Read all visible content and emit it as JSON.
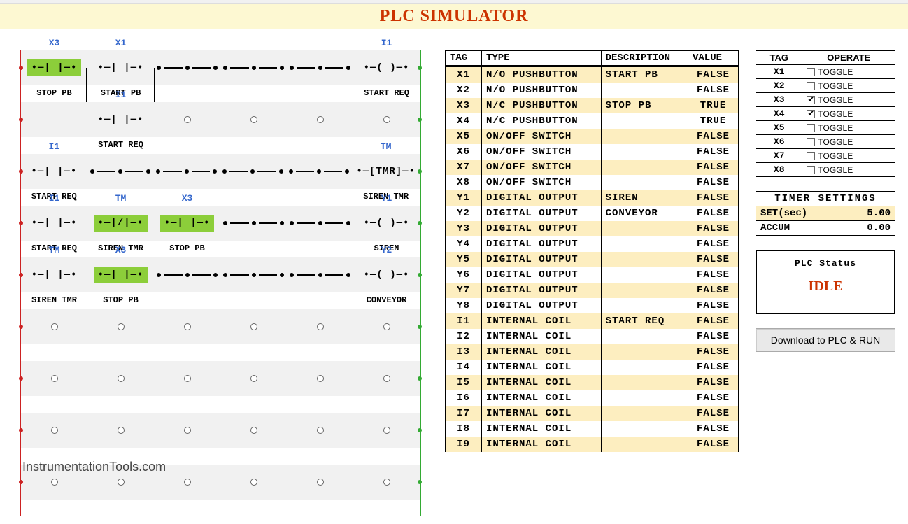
{
  "title": "PLC SIMULATOR",
  "watermark": "InstrumentationTools.com",
  "ladder": {
    "rungs": [
      {
        "slots": [
          {
            "kind": "NO",
            "tag": "X3",
            "desc": "STOP PB",
            "energized": true
          },
          {
            "kind": "NO",
            "tag": "X1",
            "desc": "START PB"
          },
          {
            "kind": "wire"
          },
          {
            "kind": "wire"
          },
          {
            "kind": "wire"
          },
          {
            "kind": "COIL",
            "tag": "I1",
            "desc": "START REQ"
          }
        ],
        "branch": {
          "under_slot": 1,
          "tag": "I1",
          "desc": "START REQ"
        }
      },
      {
        "is_branch_row": true,
        "slots": [
          {
            "kind": "empty"
          },
          {
            "kind": "NO",
            "tag": "",
            "desc": ""
          },
          {
            "kind": "hole"
          },
          {
            "kind": "hole"
          },
          {
            "kind": "hole"
          },
          {
            "kind": "hole"
          }
        ]
      },
      {
        "slots": [
          {
            "kind": "NO",
            "tag": "I1",
            "desc": "START REQ"
          },
          {
            "kind": "wire"
          },
          {
            "kind": "wire"
          },
          {
            "kind": "wire"
          },
          {
            "kind": "wire"
          },
          {
            "kind": "TMR",
            "tag": "TM",
            "desc": "SIREN TMR"
          }
        ]
      },
      {
        "slots": [
          {
            "kind": "NO",
            "tag": "I1",
            "desc": "START REQ"
          },
          {
            "kind": "NC",
            "tag": "TM",
            "desc": "SIREN TMR",
            "energized": true
          },
          {
            "kind": "NO",
            "tag": "X3",
            "desc": "STOP PB",
            "energized": true
          },
          {
            "kind": "wire"
          },
          {
            "kind": "wire"
          },
          {
            "kind": "COIL",
            "tag": "Y1",
            "desc": "SIREN"
          }
        ]
      },
      {
        "slots": [
          {
            "kind": "NO",
            "tag": "TM",
            "desc": "SIREN TMR"
          },
          {
            "kind": "NO",
            "tag": "X3",
            "desc": "STOP PB",
            "energized": true
          },
          {
            "kind": "wire"
          },
          {
            "kind": "wire"
          },
          {
            "kind": "wire"
          },
          {
            "kind": "COIL",
            "tag": "Y2",
            "desc": "CONVEYOR"
          }
        ]
      },
      {
        "slots": [
          {
            "kind": "hole"
          },
          {
            "kind": "hole"
          },
          {
            "kind": "hole"
          },
          {
            "kind": "hole"
          },
          {
            "kind": "hole"
          },
          {
            "kind": "hole"
          }
        ]
      },
      {
        "slots": [
          {
            "kind": "hole"
          },
          {
            "kind": "hole"
          },
          {
            "kind": "hole"
          },
          {
            "kind": "hole"
          },
          {
            "kind": "hole"
          },
          {
            "kind": "hole"
          }
        ]
      },
      {
        "slots": [
          {
            "kind": "hole"
          },
          {
            "kind": "hole"
          },
          {
            "kind": "hole"
          },
          {
            "kind": "hole"
          },
          {
            "kind": "hole"
          },
          {
            "kind": "hole"
          }
        ]
      },
      {
        "slots": [
          {
            "kind": "hole"
          },
          {
            "kind": "hole"
          },
          {
            "kind": "hole"
          },
          {
            "kind": "hole"
          },
          {
            "kind": "hole"
          },
          {
            "kind": "hole"
          }
        ]
      }
    ]
  },
  "tag_table": {
    "headers": [
      "TAG",
      "TYPE",
      "DESCRIPTION",
      "VALUE"
    ],
    "rows": [
      {
        "tag": "X1",
        "type": "N/O PUSHBUTTON",
        "desc": "START PB",
        "value": "FALSE"
      },
      {
        "tag": "X2",
        "type": "N/O PUSHBUTTON",
        "desc": "",
        "value": "FALSE"
      },
      {
        "tag": "X3",
        "type": "N/C PUSHBUTTON",
        "desc": "STOP PB",
        "value": "TRUE"
      },
      {
        "tag": "X4",
        "type": "N/C PUSHBUTTON",
        "desc": "",
        "value": "TRUE"
      },
      {
        "tag": "X5",
        "type": "ON/OFF SWITCH",
        "desc": "",
        "value": "FALSE"
      },
      {
        "tag": "X6",
        "type": "ON/OFF SWITCH",
        "desc": "",
        "value": "FALSE"
      },
      {
        "tag": "X7",
        "type": "ON/OFF SWITCH",
        "desc": "",
        "value": "FALSE"
      },
      {
        "tag": "X8",
        "type": "ON/OFF SWITCH",
        "desc": "",
        "value": "FALSE"
      },
      {
        "tag": "Y1",
        "type": "DIGITAL OUTPUT",
        "desc": "SIREN",
        "value": "FALSE"
      },
      {
        "tag": "Y2",
        "type": "DIGITAL OUTPUT",
        "desc": "CONVEYOR",
        "value": "FALSE"
      },
      {
        "tag": "Y3",
        "type": "DIGITAL OUTPUT",
        "desc": "",
        "value": "FALSE"
      },
      {
        "tag": "Y4",
        "type": "DIGITAL OUTPUT",
        "desc": "",
        "value": "FALSE"
      },
      {
        "tag": "Y5",
        "type": "DIGITAL OUTPUT",
        "desc": "",
        "value": "FALSE"
      },
      {
        "tag": "Y6",
        "type": "DIGITAL OUTPUT",
        "desc": "",
        "value": "FALSE"
      },
      {
        "tag": "Y7",
        "type": "DIGITAL OUTPUT",
        "desc": "",
        "value": "FALSE"
      },
      {
        "tag": "Y8",
        "type": "DIGITAL OUTPUT",
        "desc": "",
        "value": "FALSE"
      },
      {
        "tag": "I1",
        "type": "INTERNAL COIL",
        "desc": "START REQ",
        "value": "FALSE"
      },
      {
        "tag": "I2",
        "type": "INTERNAL COIL",
        "desc": "",
        "value": "FALSE"
      },
      {
        "tag": "I3",
        "type": "INTERNAL COIL",
        "desc": "",
        "value": "FALSE"
      },
      {
        "tag": "I4",
        "type": "INTERNAL COIL",
        "desc": "",
        "value": "FALSE"
      },
      {
        "tag": "I5",
        "type": "INTERNAL COIL",
        "desc": "",
        "value": "FALSE"
      },
      {
        "tag": "I6",
        "type": "INTERNAL COIL",
        "desc": "",
        "value": "FALSE"
      },
      {
        "tag": "I7",
        "type": "INTERNAL COIL",
        "desc": "",
        "value": "FALSE"
      },
      {
        "tag": "I8",
        "type": "INTERNAL COIL",
        "desc": "",
        "value": "FALSE"
      },
      {
        "tag": "I9",
        "type": "INTERNAL COIL",
        "desc": "",
        "value": "FALSE"
      }
    ]
  },
  "operate": {
    "headers": [
      "TAG",
      "OPERATE"
    ],
    "label": "TOGGLE",
    "rows": [
      {
        "tag": "X1",
        "checked": false
      },
      {
        "tag": "X2",
        "checked": false
      },
      {
        "tag": "X3",
        "checked": true
      },
      {
        "tag": "X4",
        "checked": true
      },
      {
        "tag": "X5",
        "checked": false
      },
      {
        "tag": "X6",
        "checked": false
      },
      {
        "tag": "X7",
        "checked": false
      },
      {
        "tag": "X8",
        "checked": false
      }
    ]
  },
  "timer": {
    "title": "TIMER SETTINGS",
    "rows": [
      {
        "label": "SET(sec)",
        "value": "5.00",
        "hl": true
      },
      {
        "label": "ACCUM",
        "value": "0.00",
        "hl": false
      }
    ]
  },
  "status": {
    "label": "PLC Status",
    "value": "IDLE"
  },
  "run_button": "Download to PLC & RUN"
}
